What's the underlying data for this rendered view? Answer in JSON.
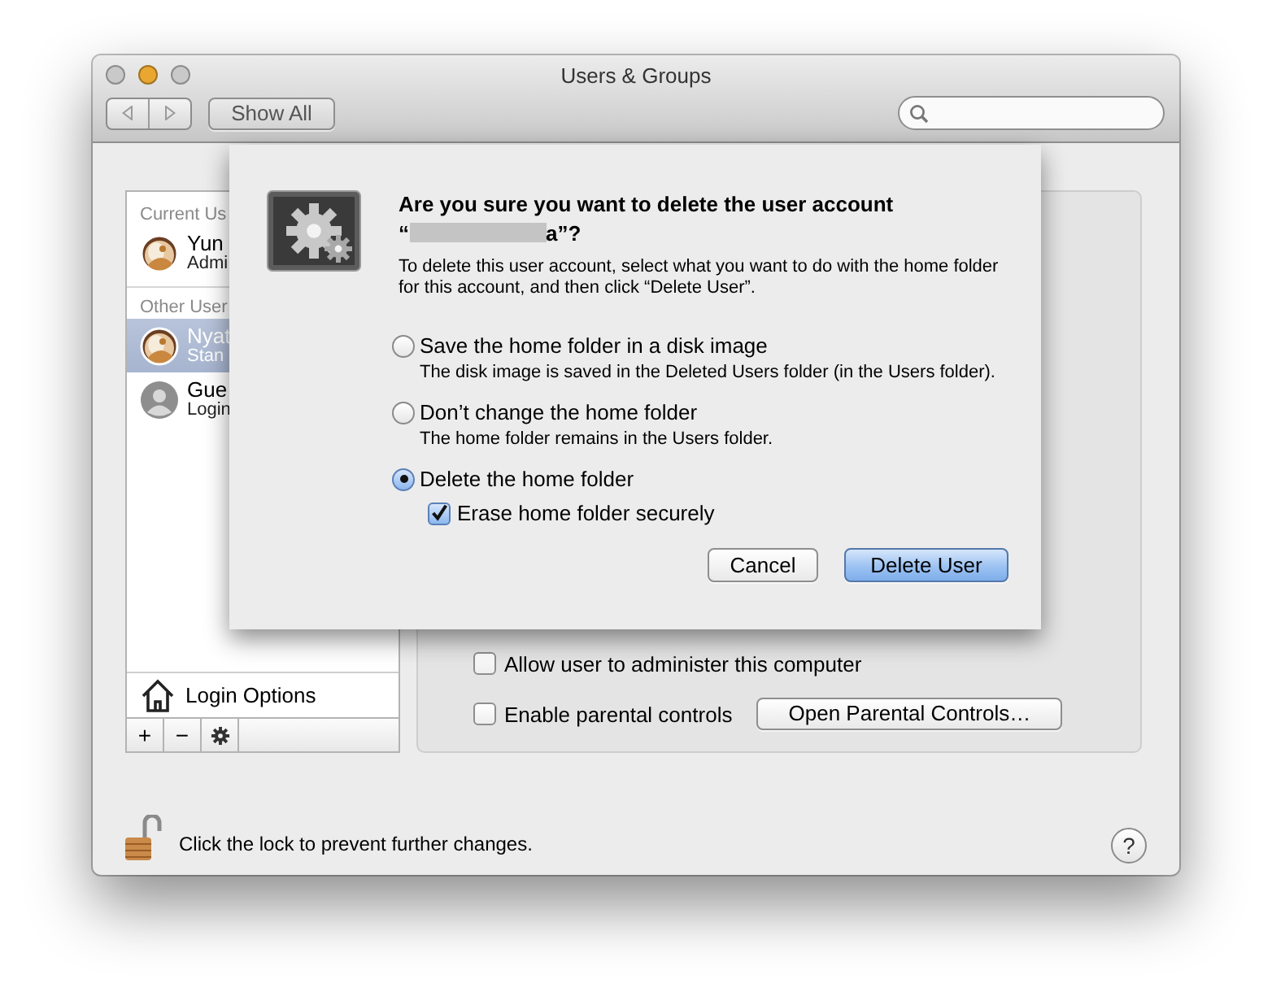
{
  "window": {
    "title": "Users & Groups",
    "controls": [
      {
        "kind": "close",
        "disabled": true
      },
      {
        "kind": "minimize",
        "disabled": false
      },
      {
        "kind": "zoom",
        "disabled": true
      }
    ]
  },
  "toolbar": {
    "show_all": "Show All"
  },
  "sidebar": {
    "sections": [
      {
        "header": "Current Us",
        "users": [
          {
            "name": "Yun",
            "role": "Admi",
            "selected": false
          }
        ]
      },
      {
        "header": "Other User",
        "users": [
          {
            "name": "Nyat",
            "role": "Stan",
            "selected": true
          },
          {
            "name": "Gue",
            "role": "Login",
            "selected": false,
            "kind": "generic"
          }
        ]
      }
    ],
    "login_options": "Login Options",
    "tools": [
      "+",
      "−"
    ]
  },
  "panel": {
    "options": [
      {
        "label": "Allow user to administer this computer",
        "checked": false
      },
      {
        "label": "Enable parental controls",
        "checked": false,
        "button": "Open Parental Controls…"
      }
    ]
  },
  "lock": {
    "locked": false,
    "text": "Click the lock to prevent further changes."
  },
  "help": "?",
  "sheet": {
    "title": "Are you sure you want to delete the user account",
    "name_open": "“",
    "name_close": "a”?",
    "message": "To delete this user account, select what you want to do with the home folder for this account, and then click “Delete User”.",
    "options": [
      {
        "label": "Save the home folder in a disk image",
        "description": "The disk image is saved in the Deleted Users folder (in the Users folder).",
        "selected": false
      },
      {
        "label": "Don’t change the home folder",
        "description": "The home folder remains in the Users folder.",
        "selected": false
      },
      {
        "label": "Delete the home folder",
        "selected": true,
        "sub_option": {
          "label": "Erase home folder securely",
          "checked": true
        }
      }
    ],
    "buttons": [
      {
        "label": "Cancel",
        "default": false
      },
      {
        "label": "Delete User",
        "default": true
      }
    ]
  }
}
